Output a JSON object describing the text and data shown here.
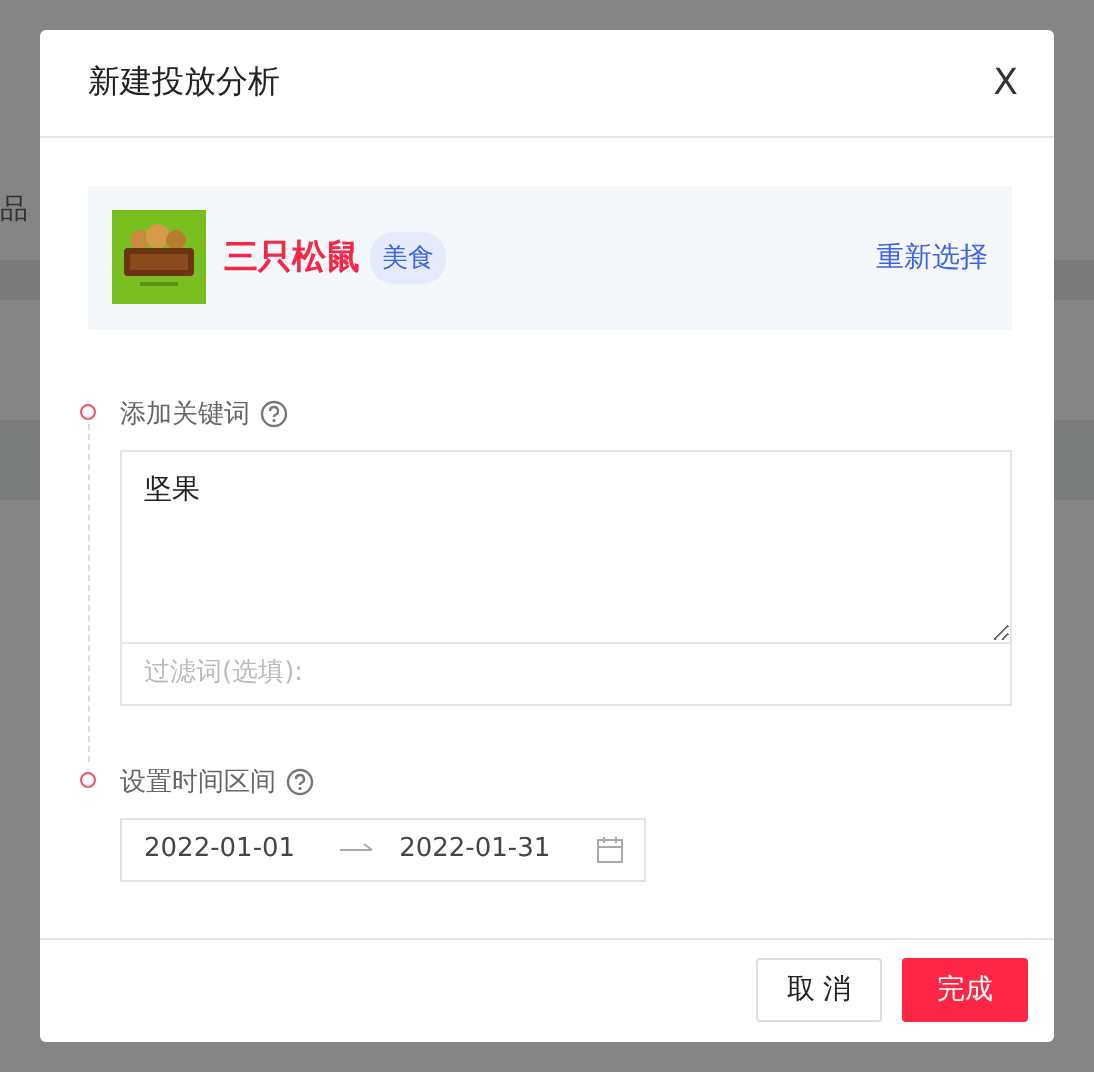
{
  "background": {
    "text": "品"
  },
  "dialog": {
    "title": "新建投放分析",
    "close": "X"
  },
  "brand": {
    "name": "三只松鼠",
    "tag": "美食",
    "reselect": "重新选择"
  },
  "steps": [
    {
      "kind": "keywords",
      "label": "添加关键词",
      "value": "坚果",
      "filter_placeholder": "过滤词(选填):"
    },
    {
      "kind": "daterange",
      "label": "设置时间区间",
      "start": "2022-01-01",
      "end": "2022-01-31"
    }
  ],
  "buttons": [
    {
      "label": "取 消",
      "primary": false
    },
    {
      "label": "完成",
      "primary": true
    }
  ]
}
